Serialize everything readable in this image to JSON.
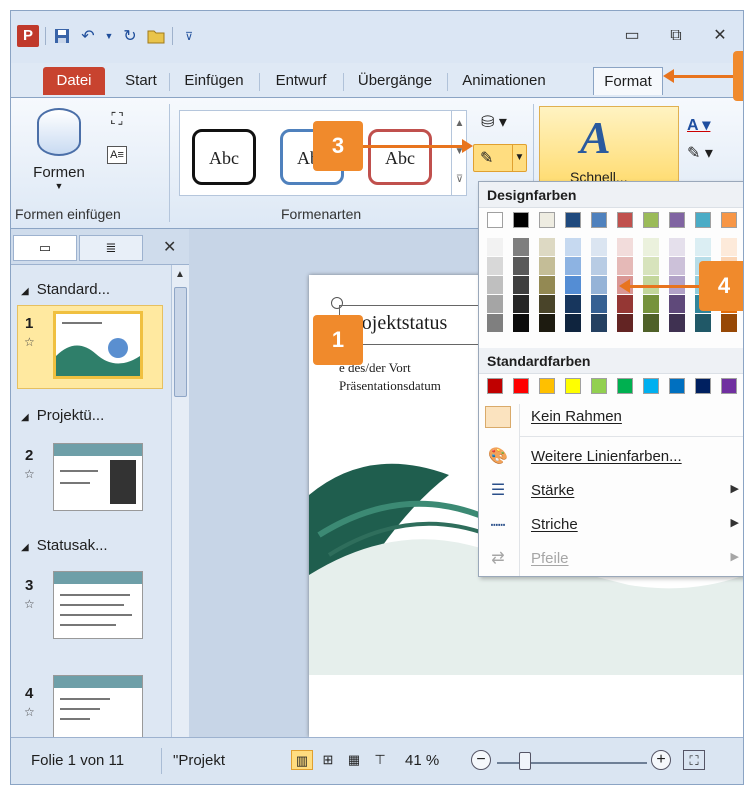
{
  "qat": {
    "app_logo": "P",
    "save": "save-icon",
    "undo": "undo-icon",
    "redo": "redo-icon",
    "open": "open-folder-icon"
  },
  "window_controls": {
    "minimize": "▭",
    "restore": "⧉",
    "close": "✕"
  },
  "tabs": [
    {
      "label": "Datei"
    },
    {
      "label": "Start"
    },
    {
      "label": "Einfügen"
    },
    {
      "label": "Entwurf"
    },
    {
      "label": "Übergänge"
    },
    {
      "label": "Animationen"
    },
    {
      "label": "Format"
    }
  ],
  "ribbon": {
    "formen_label": "Formen",
    "group_formen_einfuegen": "Formen einfügen",
    "group_formenarten": "Formenarten",
    "style_samples": [
      "Abc",
      "Abc",
      "Abc"
    ],
    "schnellformat_label": "Schnell..."
  },
  "pane": {
    "sections": [
      "Standard...",
      "Projektü...",
      "Statusak..."
    ],
    "slide_numbers": [
      "1",
      "2",
      "3",
      "4"
    ]
  },
  "slide": {
    "title": "Projektstatus",
    "subtitle_line1": "e des/der Vort",
    "subtitle_line2": "Präsentationsdatum"
  },
  "menu": {
    "theme_colors_header": "Designfarben",
    "standard_colors_header": "Standardfarben",
    "theme_top_row": [
      "#ffffff",
      "#000000",
      "#eeece1",
      "#1f497d",
      "#4f81bd",
      "#c0504d",
      "#9bbb59",
      "#8064a2",
      "#4bacc6",
      "#f79646"
    ],
    "theme_shades": [
      [
        "#f2f2f2",
        "#7f7f7f",
        "#ddd9c3",
        "#c6d9f0",
        "#dbe5f1",
        "#f2dcdb",
        "#ebf1dd",
        "#e5e0ec",
        "#dbeef3",
        "#fdeada"
      ],
      [
        "#d8d8d8",
        "#595959",
        "#c4bd97",
        "#8db3e2",
        "#b8cce4",
        "#e5b9b7",
        "#d7e3bc",
        "#ccc1d9",
        "#b7dde8",
        "#fbd5b5"
      ],
      [
        "#bfbfbf",
        "#3f3f3f",
        "#938953",
        "#548dd4",
        "#95b3d7",
        "#d99694",
        "#c3d69b",
        "#b2a2c7",
        "#92cddc",
        "#fac08f"
      ],
      [
        "#a5a5a5",
        "#262626",
        "#494429",
        "#17365d",
        "#366092",
        "#953734",
        "#76923c",
        "#5f497a",
        "#31859b",
        "#e36c09"
      ],
      [
        "#7f7f7f",
        "#0c0c0c",
        "#1d1b10",
        "#0f243e",
        "#244061",
        "#632423",
        "#4f6128",
        "#3f3151",
        "#205867",
        "#974806"
      ]
    ],
    "standard_colors": [
      "#c00000",
      "#ff0000",
      "#ffc000",
      "#ffff00",
      "#92d050",
      "#00b050",
      "#00b0f0",
      "#0070c0",
      "#002060",
      "#7030a0"
    ],
    "items": [
      {
        "label": "Kein Rahmen",
        "icon": "no-outline-icon"
      },
      {
        "label": "Weitere Linienfarben...",
        "icon": "palette-icon"
      },
      {
        "label": "Stärke",
        "icon": "line-weight-icon"
      },
      {
        "label": "Striche",
        "icon": "dash-icon"
      },
      {
        "label": "Pfeile",
        "icon": "arrows-icon"
      }
    ]
  },
  "status": {
    "slide_info": "Folie 1 von 11",
    "theme": "\"Projekt",
    "zoom": "41 %"
  },
  "callouts": [
    "1",
    "3",
    "4"
  ]
}
